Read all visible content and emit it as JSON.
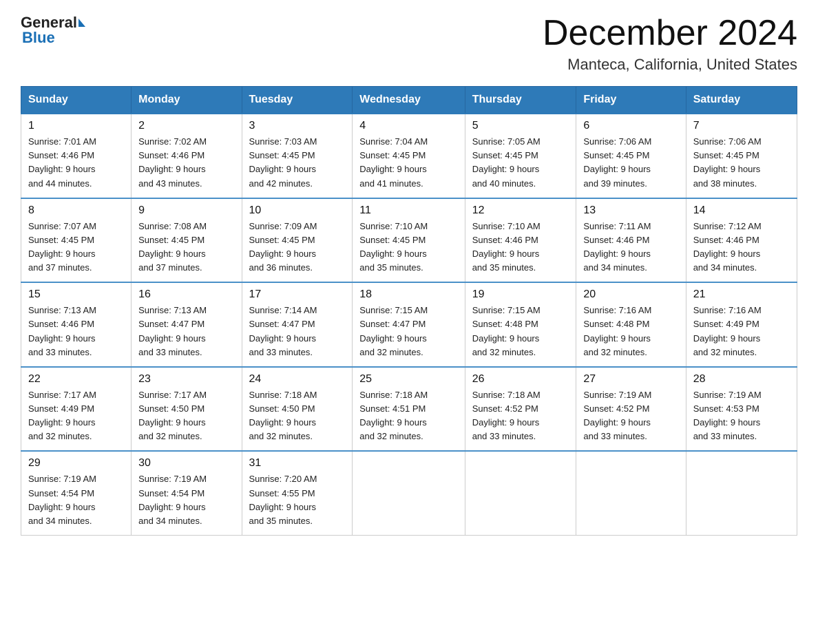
{
  "logo": {
    "general": "General",
    "blue": "Blue"
  },
  "header": {
    "month": "December 2024",
    "location": "Manteca, California, United States"
  },
  "weekdays": [
    "Sunday",
    "Monday",
    "Tuesday",
    "Wednesday",
    "Thursday",
    "Friday",
    "Saturday"
  ],
  "weeks": [
    [
      {
        "day": "1",
        "sunrise": "7:01 AM",
        "sunset": "4:46 PM",
        "daylight": "9 hours and 44 minutes."
      },
      {
        "day": "2",
        "sunrise": "7:02 AM",
        "sunset": "4:46 PM",
        "daylight": "9 hours and 43 minutes."
      },
      {
        "day": "3",
        "sunrise": "7:03 AM",
        "sunset": "4:45 PM",
        "daylight": "9 hours and 42 minutes."
      },
      {
        "day": "4",
        "sunrise": "7:04 AM",
        "sunset": "4:45 PM",
        "daylight": "9 hours and 41 minutes."
      },
      {
        "day": "5",
        "sunrise": "7:05 AM",
        "sunset": "4:45 PM",
        "daylight": "9 hours and 40 minutes."
      },
      {
        "day": "6",
        "sunrise": "7:06 AM",
        "sunset": "4:45 PM",
        "daylight": "9 hours and 39 minutes."
      },
      {
        "day": "7",
        "sunrise": "7:06 AM",
        "sunset": "4:45 PM",
        "daylight": "9 hours and 38 minutes."
      }
    ],
    [
      {
        "day": "8",
        "sunrise": "7:07 AM",
        "sunset": "4:45 PM",
        "daylight": "9 hours and 37 minutes."
      },
      {
        "day": "9",
        "sunrise": "7:08 AM",
        "sunset": "4:45 PM",
        "daylight": "9 hours and 37 minutes."
      },
      {
        "day": "10",
        "sunrise": "7:09 AM",
        "sunset": "4:45 PM",
        "daylight": "9 hours and 36 minutes."
      },
      {
        "day": "11",
        "sunrise": "7:10 AM",
        "sunset": "4:45 PM",
        "daylight": "9 hours and 35 minutes."
      },
      {
        "day": "12",
        "sunrise": "7:10 AM",
        "sunset": "4:46 PM",
        "daylight": "9 hours and 35 minutes."
      },
      {
        "day": "13",
        "sunrise": "7:11 AM",
        "sunset": "4:46 PM",
        "daylight": "9 hours and 34 minutes."
      },
      {
        "day": "14",
        "sunrise": "7:12 AM",
        "sunset": "4:46 PM",
        "daylight": "9 hours and 34 minutes."
      }
    ],
    [
      {
        "day": "15",
        "sunrise": "7:13 AM",
        "sunset": "4:46 PM",
        "daylight": "9 hours and 33 minutes."
      },
      {
        "day": "16",
        "sunrise": "7:13 AM",
        "sunset": "4:47 PM",
        "daylight": "9 hours and 33 minutes."
      },
      {
        "day": "17",
        "sunrise": "7:14 AM",
        "sunset": "4:47 PM",
        "daylight": "9 hours and 33 minutes."
      },
      {
        "day": "18",
        "sunrise": "7:15 AM",
        "sunset": "4:47 PM",
        "daylight": "9 hours and 32 minutes."
      },
      {
        "day": "19",
        "sunrise": "7:15 AM",
        "sunset": "4:48 PM",
        "daylight": "9 hours and 32 minutes."
      },
      {
        "day": "20",
        "sunrise": "7:16 AM",
        "sunset": "4:48 PM",
        "daylight": "9 hours and 32 minutes."
      },
      {
        "day": "21",
        "sunrise": "7:16 AM",
        "sunset": "4:49 PM",
        "daylight": "9 hours and 32 minutes."
      }
    ],
    [
      {
        "day": "22",
        "sunrise": "7:17 AM",
        "sunset": "4:49 PM",
        "daylight": "9 hours and 32 minutes."
      },
      {
        "day": "23",
        "sunrise": "7:17 AM",
        "sunset": "4:50 PM",
        "daylight": "9 hours and 32 minutes."
      },
      {
        "day": "24",
        "sunrise": "7:18 AM",
        "sunset": "4:50 PM",
        "daylight": "9 hours and 32 minutes."
      },
      {
        "day": "25",
        "sunrise": "7:18 AM",
        "sunset": "4:51 PM",
        "daylight": "9 hours and 32 minutes."
      },
      {
        "day": "26",
        "sunrise": "7:18 AM",
        "sunset": "4:52 PM",
        "daylight": "9 hours and 33 minutes."
      },
      {
        "day": "27",
        "sunrise": "7:19 AM",
        "sunset": "4:52 PM",
        "daylight": "9 hours and 33 minutes."
      },
      {
        "day": "28",
        "sunrise": "7:19 AM",
        "sunset": "4:53 PM",
        "daylight": "9 hours and 33 minutes."
      }
    ],
    [
      {
        "day": "29",
        "sunrise": "7:19 AM",
        "sunset": "4:54 PM",
        "daylight": "9 hours and 34 minutes."
      },
      {
        "day": "30",
        "sunrise": "7:19 AM",
        "sunset": "4:54 PM",
        "daylight": "9 hours and 34 minutes."
      },
      {
        "day": "31",
        "sunrise": "7:20 AM",
        "sunset": "4:55 PM",
        "daylight": "9 hours and 35 minutes."
      },
      null,
      null,
      null,
      null
    ]
  ],
  "labels": {
    "sunrise": "Sunrise:",
    "sunset": "Sunset:",
    "daylight": "Daylight:"
  }
}
